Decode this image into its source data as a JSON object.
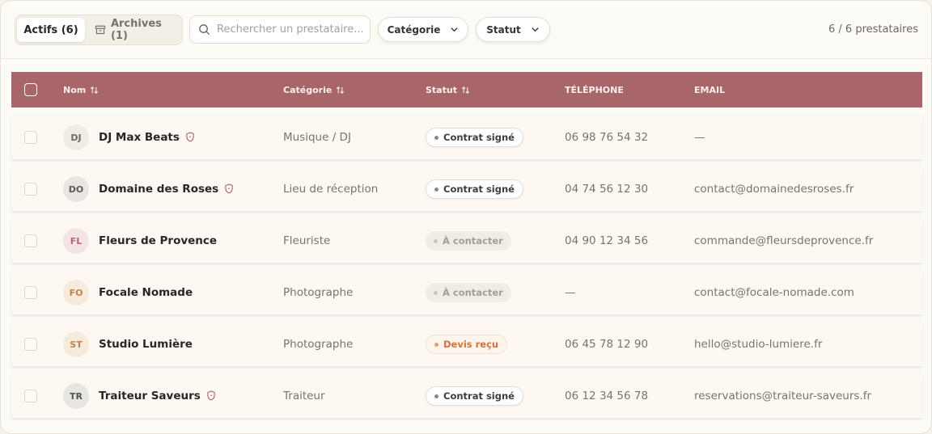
{
  "toolbar": {
    "tab_active_label": "Actifs (6)",
    "tab_archive_label": "Archives (1)",
    "search_placeholder": "Rechercher un prestataire...",
    "filter_category_label": "Catégorie",
    "filter_status_label": "Statut",
    "count_label": "6 / 6 prestataires"
  },
  "table": {
    "columns": {
      "name": "Nom",
      "category": "Catégorie",
      "status": "Statut",
      "phone": "TÉLÉPHONE",
      "email": "EMAIL"
    },
    "rows": [
      {
        "initials": "DJ",
        "name": "DJ Max Beats",
        "shield": true,
        "category": "Musique / DJ",
        "status": "Contrat signé",
        "status_kind": "signed",
        "phone": "06 98 76 54 32",
        "email": "—",
        "avatar_bg": "#efebe5",
        "avatar_fg": "#6f6863"
      },
      {
        "initials": "DO",
        "name": "Domaine des Roses",
        "shield": true,
        "category": "Lieu de réception",
        "status": "Contrat signé",
        "status_kind": "signed",
        "phone": "04 74 56 12 30",
        "email": "contact@domainedesroses.fr",
        "avatar_bg": "#e9e6e1",
        "avatar_fg": "#5f5a56"
      },
      {
        "initials": "FL",
        "name": "Fleurs de Provence",
        "shield": false,
        "category": "Fleuriste",
        "status": "À contacter",
        "status_kind": "contact",
        "phone": "04 90 12 34 56",
        "email": "commande@fleursdeprovence.fr",
        "avatar_bg": "#f4e4e6",
        "avatar_fg": "#b3666f"
      },
      {
        "initials": "FO",
        "name": "Focale Nomade",
        "shield": false,
        "category": "Photographe",
        "status": "À contacter",
        "status_kind": "contact",
        "phone": "—",
        "email": "contact@focale-nomade.com",
        "avatar_bg": "#f6eadb",
        "avatar_fg": "#c0844f"
      },
      {
        "initials": "ST",
        "name": "Studio Lumière",
        "shield": false,
        "category": "Photographe",
        "status": "Devis reçu",
        "status_kind": "devis",
        "phone": "06 45 78 12 90",
        "email": "hello@studio-lumiere.fr",
        "avatar_bg": "#f6eadb",
        "avatar_fg": "#c0844f"
      },
      {
        "initials": "TR",
        "name": "Traiteur Saveurs",
        "shield": true,
        "category": "Traiteur",
        "status": "Contrat signé",
        "status_kind": "signed",
        "phone": "06 12 34 56 78",
        "email": "reservations@traiteur-saveurs.fr",
        "avatar_bg": "#e4e6df",
        "avatar_fg": "#4f5a4f"
      }
    ]
  },
  "colors": {
    "header_bg": "#a8666a",
    "shield_icon": "#a8666a"
  }
}
